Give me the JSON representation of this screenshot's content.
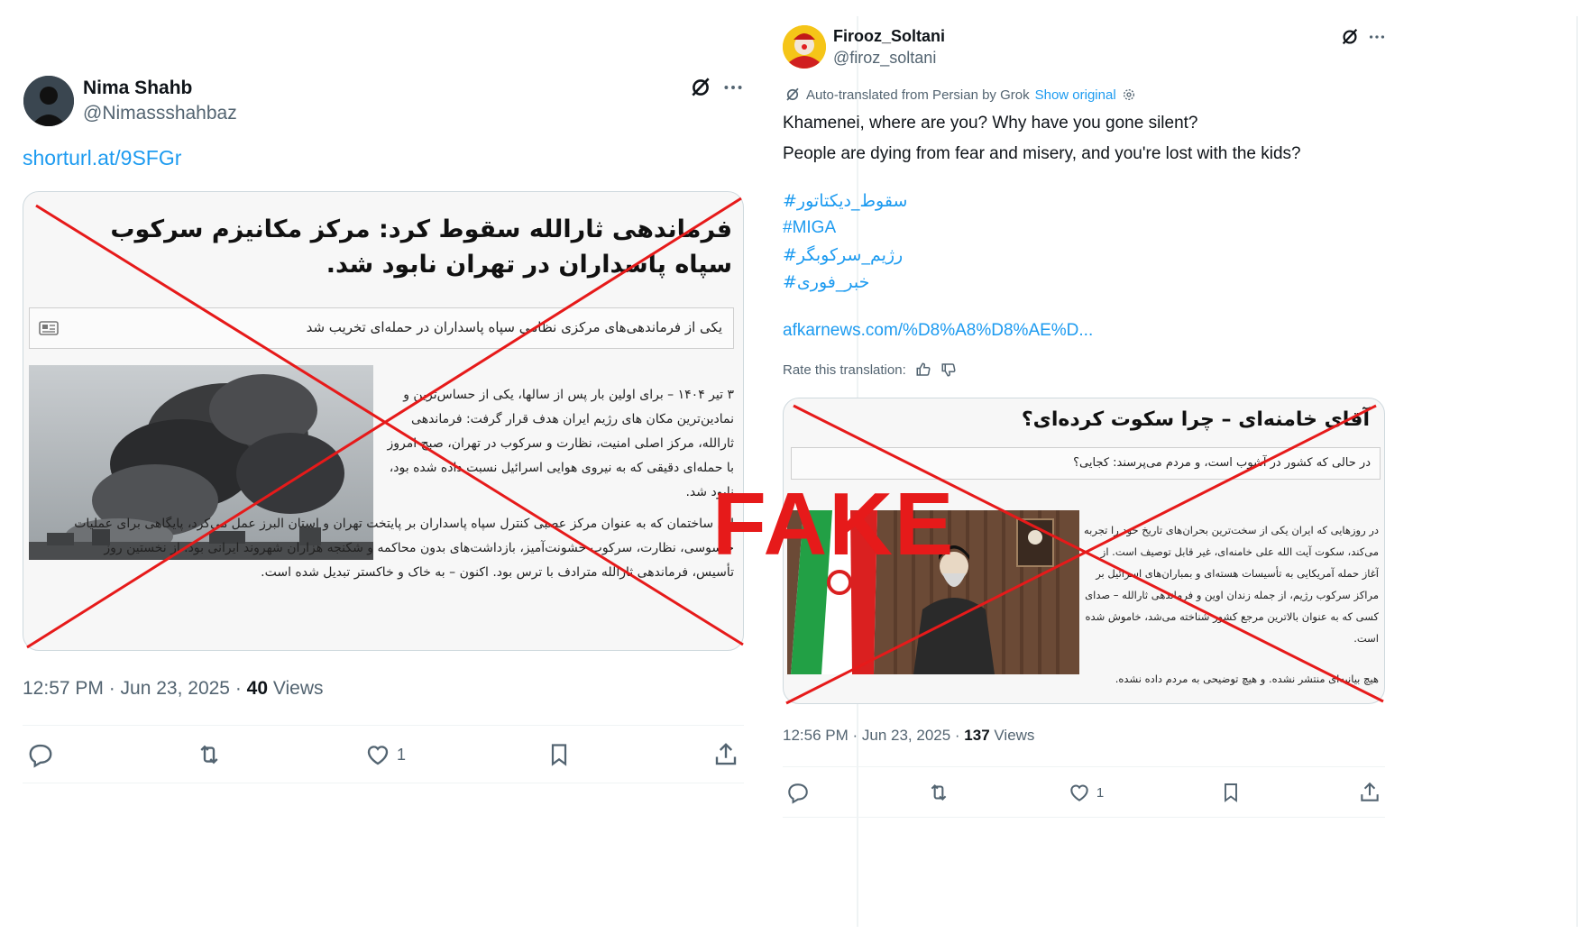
{
  "left_tweet": {
    "author_name": "Nima Shahb",
    "author_handle": "@Nimassshahbaz",
    "link": "shorturl.at/9SFGr",
    "card": {
      "headline": "فرماندهی ثارالله سقوط کرد: مرکز مکانیزم سرکوب سپاه پاسداران در تهران نابود شد.",
      "subheadline": "یکی از فرماندهی‌های مرکزی نظامی سپاه پاسداران در حمله‌ای تخریب شد",
      "body_p1": "۳ تیر ۱۴۰۴ – برای اولین بار پس از سالها، یکی از حساس‌ترین و نمادین‌ترین مکان های رژیم ایران هدف قرار گرفت: فرماندهی ثارالله، مرکز اصلی امنیت، نظارت و سرکوب در تهران، صبح امروز با حمله‌ای دقیقی که به نیروی هوایی اسرائیل نسبت داده شده بود، نابود شد.",
      "body_p2": "این ساختمان که به عنوان مرکز عصبی کنترل سپاه پاسداران بر پایتخت تهران و استان البرز عمل می‌کرد، پایگاهی برای عملیات جاسوسی، نظارت، سرکوب خشونت‌آمیز، بازداشت‌های بدون محاکمه و شکنجه هزاران شهروند ایرانی بود. از نخستین روز تأسیس، فرماندهی ثارالله مترادف با ترس بود. اکنون – به خاک و خاکستر تبدیل شده است."
    },
    "time": "12:57 PM · Jun 23, 2025 · ",
    "views_count": "40",
    "views_label": " Views",
    "likes": "1"
  },
  "right_tweet": {
    "author_name": "Firooz_Soltani",
    "author_handle": "@firoz_soltani",
    "translation_note": "Auto-translated from Persian by Grok",
    "show_original": "Show original",
    "text_line1": "Khamenei, where are you? Why have you gone silent?",
    "text_line2": "People are dying from fear and misery, and you're lost with the kids?",
    "hashtags": [
      "#سقوط_دیکتاتور",
      "#MIGA",
      "#رژیم_سرکوبگر",
      "#خبر_فوری"
    ],
    "link": "afkarnews.com/%D8%A8%D8%AE%D...",
    "rate_label": "Rate this translation:",
    "card": {
      "headline": "آقای خامنه‌ای – چرا سکوت کرده‌ای؟",
      "subheadline": "در حالی که کشور در آشوب است، و مردم می‌پرسند: کجایی؟",
      "body_p1": "در روزهایی که ایران یکی از سخت‌ترین بحران‌های تاریخ خود را تجربه می‌کند، سکوت آیت الله علی خامنه‌ای، غیر قابل توصیف است. از آغاز حمله آمریکایی به تأسیسات هسته‌ای و بمباران‌های اسرائیل بر مراکز سرکوب رژیم، از جمله زندان اوین و فرماندهی ثارالله – صدای کسی که به عنوان بالاترین مرجع کشور شناخته می‌شد، خاموش شده است.",
      "body_p2": "هیچ بیانیه‌ای منتشر نشده. و هیچ توضیحی به مردم داده نشده."
    },
    "time": "12:56 PM · Jun 23, 2025 · ",
    "views_count": "137",
    "views_label": " Views",
    "likes": "1"
  },
  "overlay_label": "FAKE",
  "colors": {
    "link": "#1d9bf0",
    "secondary_text": "#536471",
    "fake_red": "#e61a1a",
    "border": "#cfd9de"
  },
  "icons": [
    "grok-icon",
    "more-icon",
    "reply-icon",
    "retweet-icon",
    "like-icon",
    "bookmark-icon",
    "share-icon",
    "gear-icon",
    "thumbs-up-icon",
    "thumbs-down-icon"
  ]
}
